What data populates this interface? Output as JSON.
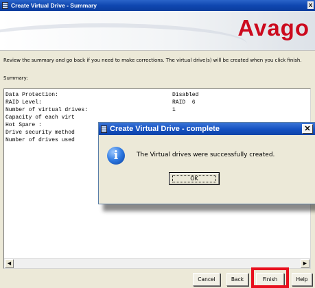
{
  "window": {
    "title": "Create Virtual Drive - Summary",
    "close_glyph": "x"
  },
  "banner": {
    "logo_text": "Avago",
    "logo_color": "#cc0a1e"
  },
  "instructions": "Review the summary and go back if you need to make corrections. The virtual drive(s) will be created when you click finish.",
  "summary_label": "Summary:",
  "summary_rows": [
    {
      "key": "Data Protection:",
      "value": "Disabled"
    },
    {
      "key": "RAID Level:",
      "value": "RAID  6"
    },
    {
      "key": "Number of virtual drives:",
      "value": "1"
    },
    {
      "key": "Capacity of each virt",
      "value": ""
    },
    {
      "key": "Hot Spare :",
      "value": ""
    },
    {
      "key": "Drive security method",
      "value": ""
    },
    {
      "key": "Number of drives used",
      "value": ""
    }
  ],
  "scrollbar": {
    "left_arrow": "◀",
    "right_arrow": "▶"
  },
  "dialog": {
    "title": "Create Virtual Drive - complete",
    "close_glyph": "✕",
    "icon": "info-icon",
    "icon_glyph": "i",
    "message": "The Virtual drives were successfully created.",
    "ok_label": "OK"
  },
  "buttons": {
    "cancel": "Cancel",
    "back": "Back",
    "finish": "Finish",
    "help": "Help"
  },
  "highlight_color": "#e8101e"
}
